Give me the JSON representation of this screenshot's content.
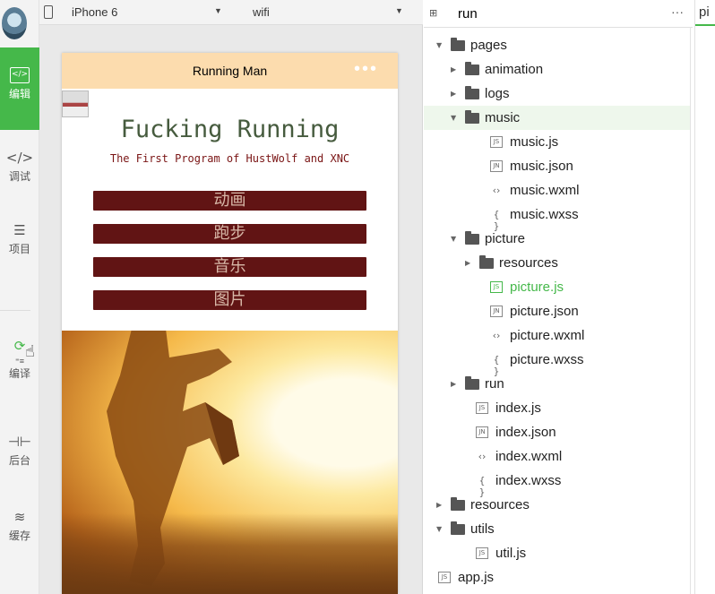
{
  "toolbar": {
    "tools": [
      {
        "id": "editor",
        "label": "编辑",
        "icon": "code-box-icon",
        "glyph": "</>"
      },
      {
        "id": "debug",
        "label": "调试",
        "icon": "code-icon",
        "glyph": "</>"
      },
      {
        "id": "project",
        "label": "项目",
        "icon": "menu-icon",
        "glyph": "☰"
      },
      {
        "id": "compile",
        "label": "编译",
        "icon": "compile-icon",
        "glyph": "⟳"
      },
      {
        "id": "backend",
        "label": "后台",
        "icon": "backend-icon",
        "glyph": "⊣⊢"
      },
      {
        "id": "cache",
        "label": "缓存",
        "icon": "layers-icon",
        "glyph": "≋"
      }
    ],
    "accent": "#45b84a"
  },
  "simulator": {
    "device": "iPhone 6",
    "network": "wifi",
    "page": {
      "nav_title": "Running Man",
      "nav_dots": "•••",
      "nav_color": "#fcdcae",
      "title": "Fucking Running",
      "subtitle": "The First Program of HustWolf and XNC",
      "buttons": [
        "动画",
        "跑步",
        "音乐",
        "图片"
      ],
      "button_color": "#611414"
    }
  },
  "explorer": {
    "title": "run",
    "more": "···",
    "tree": [
      {
        "label": "pages",
        "type": "folder",
        "open": true,
        "depth": 0
      },
      {
        "label": "animation",
        "type": "folder",
        "open": false,
        "depth": 1
      },
      {
        "label": "logs",
        "type": "folder",
        "open": false,
        "depth": 1
      },
      {
        "label": "music",
        "type": "folder",
        "open": true,
        "depth": 1,
        "selected": true
      },
      {
        "label": "music.js",
        "type": "js",
        "depth": 2
      },
      {
        "label": "music.json",
        "type": "json",
        "depth": 2
      },
      {
        "label": "music.wxml",
        "type": "wxml",
        "depth": 2
      },
      {
        "label": "music.wxss",
        "type": "wxss",
        "depth": 2
      },
      {
        "label": "picture",
        "type": "folder",
        "open": true,
        "depth": 1
      },
      {
        "label": "resources",
        "type": "folder",
        "open": false,
        "depth": 2
      },
      {
        "label": "picture.js",
        "type": "js",
        "depth": 2,
        "active": true
      },
      {
        "label": "picture.json",
        "type": "json",
        "depth": 2
      },
      {
        "label": "picture.wxml",
        "type": "wxml",
        "depth": 2
      },
      {
        "label": "picture.wxss",
        "type": "wxss",
        "depth": 2
      },
      {
        "label": "run",
        "type": "folder",
        "open": false,
        "depth": 1
      },
      {
        "label": "index.js",
        "type": "js",
        "depth": 1
      },
      {
        "label": "index.json",
        "type": "json",
        "depth": 1
      },
      {
        "label": "index.wxml",
        "type": "wxml",
        "depth": 1
      },
      {
        "label": "index.wxss",
        "type": "wxss",
        "depth": 1
      },
      {
        "label": "resources",
        "type": "folder",
        "open": false,
        "depth": 0
      },
      {
        "label": "utils",
        "type": "folder",
        "open": true,
        "depth": 0
      },
      {
        "label": "util.js",
        "type": "js",
        "depth": 1
      },
      {
        "label": "app.js",
        "type": "js",
        "depth": -1
      }
    ],
    "file_badges": {
      "js": "JS",
      "json": "JN",
      "wxml": "‹›",
      "wxss": "{ }"
    }
  },
  "editor": {
    "tab_label": "pi"
  }
}
